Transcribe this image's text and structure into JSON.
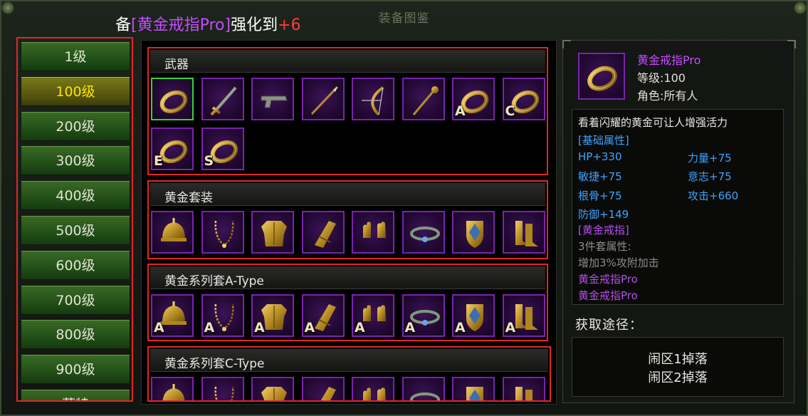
{
  "window": {
    "title": "装备图鉴"
  },
  "notice": {
    "prefix": "备",
    "item": "[黄金戒指Pro]",
    "middle": "强化到",
    "value": "+6"
  },
  "levels": [
    "1级",
    "100级",
    "200级",
    "300级",
    "400级",
    "500级",
    "600级",
    "700级",
    "800级",
    "900级",
    "萨特"
  ],
  "selected_level": "100级",
  "sections": [
    {
      "title": "武器",
      "items": [
        {
          "icon": "ring-icon",
          "tag": ""
        },
        {
          "icon": "sword-icon",
          "tag": ""
        },
        {
          "icon": "pistol-icon",
          "tag": ""
        },
        {
          "icon": "spear-icon",
          "tag": ""
        },
        {
          "icon": "bow-icon",
          "tag": ""
        },
        {
          "icon": "staff-icon",
          "tag": ""
        },
        {
          "icon": "ring-icon",
          "tag": "A"
        },
        {
          "icon": "ring-icon",
          "tag": "C"
        },
        {
          "icon": "ring-icon",
          "tag": "E"
        },
        {
          "icon": "ring-icon",
          "tag": "S"
        }
      ]
    },
    {
      "title": "黄金套装",
      "items": [
        {
          "icon": "helmet-icon",
          "tag": ""
        },
        {
          "icon": "necklace-icon",
          "tag": ""
        },
        {
          "icon": "armor-icon",
          "tag": ""
        },
        {
          "icon": "pants-icon",
          "tag": ""
        },
        {
          "icon": "gloves-icon",
          "tag": ""
        },
        {
          "icon": "belt-icon",
          "tag": ""
        },
        {
          "icon": "shield-icon",
          "tag": ""
        },
        {
          "icon": "boots-icon",
          "tag": ""
        }
      ]
    },
    {
      "title": "黄金系列套A-Type",
      "items": [
        {
          "icon": "helmet-icon",
          "tag": "A"
        },
        {
          "icon": "necklace-icon",
          "tag": "A"
        },
        {
          "icon": "armor-icon",
          "tag": "A"
        },
        {
          "icon": "pants-icon",
          "tag": "A"
        },
        {
          "icon": "gloves-icon",
          "tag": "A"
        },
        {
          "icon": "belt-icon",
          "tag": "A"
        },
        {
          "icon": "shield-icon",
          "tag": "A"
        },
        {
          "icon": "boots-icon",
          "tag": "A"
        }
      ]
    },
    {
      "title": "黄金系列套C-Type",
      "items": [
        {
          "icon": "helmet-icon",
          "tag": ""
        },
        {
          "icon": "necklace-icon",
          "tag": ""
        },
        {
          "icon": "armor-icon",
          "tag": ""
        },
        {
          "icon": "pants-icon",
          "tag": ""
        },
        {
          "icon": "gloves-icon",
          "tag": ""
        },
        {
          "icon": "belt-icon",
          "tag": ""
        },
        {
          "icon": "shield-icon",
          "tag": ""
        },
        {
          "icon": "boots-icon",
          "tag": ""
        }
      ]
    }
  ],
  "detail": {
    "icon": "ring-icon",
    "name": "黄金戒指Pro",
    "level": "等级:100",
    "role": "角色:所有人",
    "description": "看着闪耀的黄金可让人增强活力",
    "base_header": "[基础属性]",
    "stats": [
      "HP+330",
      "力量+75",
      "敏捷+75",
      "意志+75",
      "根骨+75",
      "攻击+660",
      "防御+149"
    ],
    "set_name": "[黄金戒指]",
    "set_count": "3件套属性:",
    "set_bonus": "增加3%攻附加击",
    "set_members": [
      "黄金戒指Pro",
      "黄金戒指Pro"
    ],
    "obtain_title": "获取途径：",
    "sources": [
      "闹区1掉落",
      "闹区2掉落"
    ]
  },
  "colors": {
    "accent_purple": "#c24dff",
    "highlight_red": "#e42525",
    "stat_blue": "#3fa2ff",
    "selected_yellow": "#ffe400"
  }
}
